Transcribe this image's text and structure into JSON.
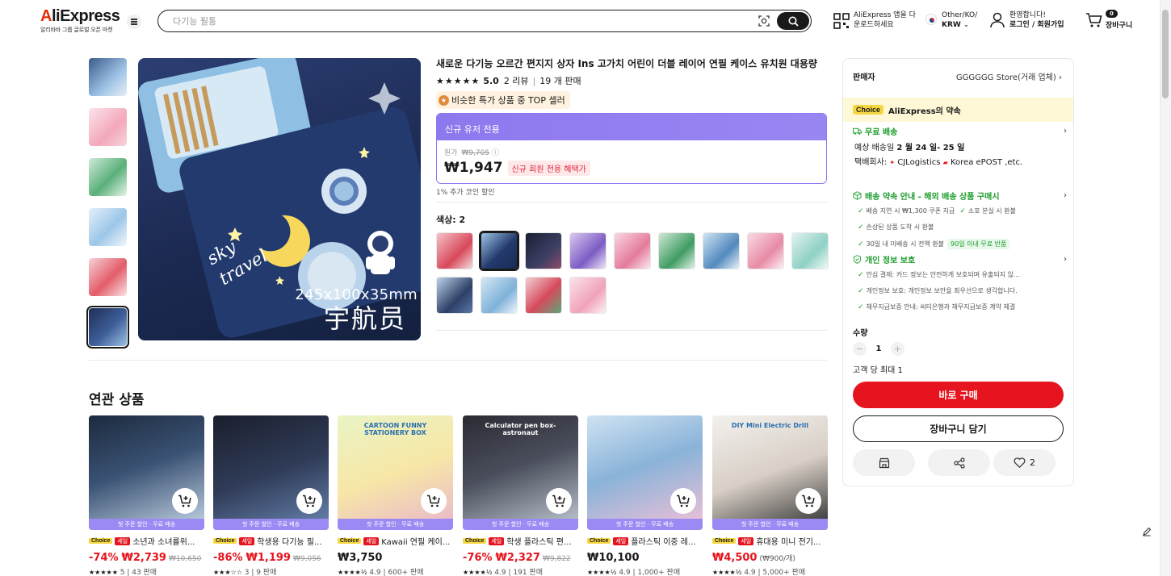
{
  "header": {
    "logo": "AliExpress",
    "logo_sub": "알리바바 그룹 글로벌 오픈 마켓",
    "search_placeholder": "다기능 필통",
    "app_line1": "AliExpress 앱을 다",
    "app_line2": "운로드하세요",
    "lang_line1": "Other/KO/",
    "lang_line2": "KRW",
    "login_line1": "환영합니다!",
    "login_line2": "로그인 / 회원가입",
    "cart_count": "0",
    "cart_label": "장바구니"
  },
  "gallery": {
    "dimension_text": "245x100x35mm",
    "chinese_text": "宇航员",
    "thumb_count": 6,
    "active_index": 5
  },
  "product": {
    "title": "새로운 다기능 오르간 편지지 상자 Ins 고가치 어린이 더블 레이어 연필 케이스 유치원 대용량",
    "stars": "★★★★★",
    "rating": "5.0",
    "reviews": "2 리뷰",
    "sold": "19 개 판매",
    "top_badge": "비슷한 특가 상품 중 TOP 셀러",
    "promo_header": "신규 유저 전용",
    "orig_label": "원가",
    "orig_price": "₩9,705",
    "price": "₩1,947",
    "price_tag": "신규 회원 전용 혜택가",
    "coin_text": "1% 추가 코인 할인",
    "color_label": "색상: 2"
  },
  "panel": {
    "seller_label": "판매자",
    "seller_name": "GGGGGG Store(거래 업체)",
    "choice_badge": "Choice",
    "choice_text": "AliExpress의 약속",
    "shipping_title": "무료 배송",
    "delivery_prefix": "예상 배송일",
    "delivery_date": "2 월 24 일- 25 일",
    "carrier_text": "택배회사:",
    "carrier1": "CJLogistics",
    "carrier2": "Korea ePOST ,etc.",
    "guarantee_title": "배송 약속 안내 - 해외 배송 상품 구매시",
    "g1": "배송 지연 시 ₩1,300 쿠폰 지급",
    "g2": "소포 분실 시 환불",
    "g3": "손상된 상품 도착 시 환불",
    "g4": "30일 내 미배송 시 전액 환불",
    "g4_tag": "90일 이내 무료 반품",
    "privacy_title": "개인 정보 보호",
    "p1": "안심 결제: 카드 정보는 안전하게 보호되며 유출되지 않...",
    "p2": "개인정보 보호: 개인정보 보안을 최우선으로 생각합니다.",
    "p3": "채무지급보증 안내: 씨티은행과 채무지급보증 계약 체결",
    "qty_label": "수량",
    "qty_value": "1",
    "qty_max": "고객 당 최대 1",
    "buy_label": "바로 구매",
    "cart_label": "장바구니 담기",
    "like_count": "2"
  },
  "related": {
    "title": "연관 상품",
    "strip_text": "첫 주문 할인 · 무료 배송",
    "items": [
      {
        "choice": "Choice",
        "sale": "세일",
        "name": "소년과 소녀를위...",
        "discount": "-74%",
        "price": "₩2,739",
        "was": "₩10,650",
        "unit": "",
        "stars": "★★★★★",
        "meta": "5 | 43 판매"
      },
      {
        "choice": "Choice",
        "sale": "세일",
        "name": "학생용 다기능 필...",
        "discount": "-86%",
        "price": "₩1,199",
        "was": "₩9,056",
        "unit": "",
        "stars": "★★★☆☆",
        "meta": "3 | 9 판매"
      },
      {
        "choice": "Choice",
        "sale": "세일",
        "name": "Kawaii 연필 케이...",
        "discount": "",
        "price": "₩3,750",
        "was": "",
        "unit": "",
        "stars": "★★★★½",
        "meta": "4.9 | 600+ 판매"
      },
      {
        "choice": "Choice",
        "sale": "세일",
        "name": "학생 플라스틱 편...",
        "discount": "-76%",
        "price": "₩2,327",
        "was": "₩9,822",
        "unit": "",
        "stars": "★★★★½",
        "meta": "4.9 | 191 판매"
      },
      {
        "choice": "Choice",
        "sale": "세일",
        "name": "플라스틱 이중 레...",
        "discount": "",
        "price": "₩10,100",
        "was": "",
        "unit": "",
        "stars": "★★★★½",
        "meta": "4.9 | 1,000+ 판매"
      },
      {
        "choice": "Choice",
        "sale": "세일",
        "name": "휴대용 미니 전기...",
        "discount": "",
        "price": "₩4,500",
        "was": "",
        "unit": "(₩900/개)",
        "stars": "★★★★½",
        "meta": "4.9 | 5,000+ 판매"
      }
    ],
    "img_texts": [
      "",
      "",
      "CARTOON FUNNY STATIONERY BOX",
      "Calculator pen box-astronaut",
      "",
      "DIY Mini Electric Drill"
    ]
  },
  "colors": {
    "brand_red": "#e62e04",
    "buy_red": "#e5141e",
    "promo_purple": "#8e78ee",
    "green": "#1a9d2b"
  }
}
